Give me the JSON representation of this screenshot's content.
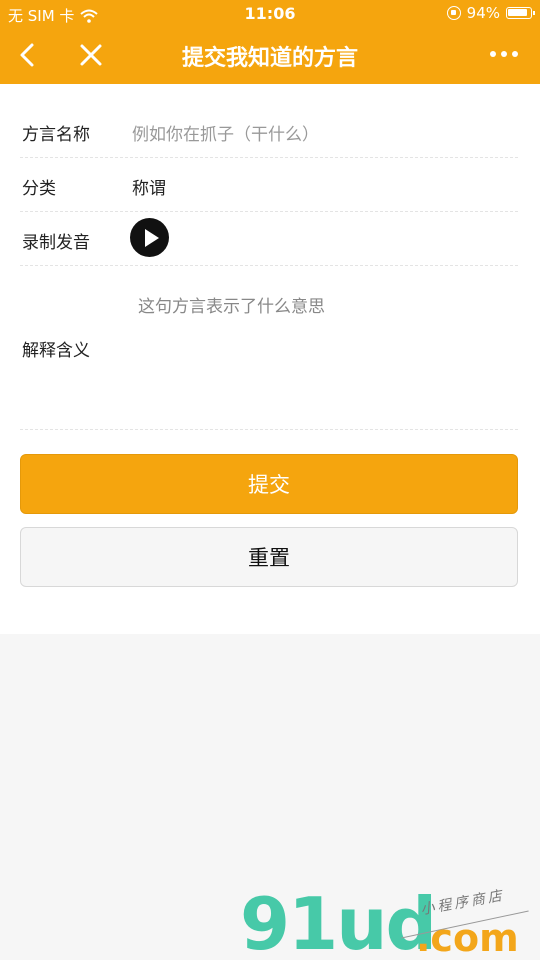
{
  "status_bar": {
    "carrier": "无 SIM 卡",
    "time": "11:06",
    "battery": "94%"
  },
  "nav": {
    "title": "提交我知道的方言"
  },
  "form": {
    "name_label": "方言名称",
    "name_placeholder": "例如你在抓子（干什么）",
    "category_label": "分类",
    "category_value": "称谓",
    "record_label": "录制发音",
    "explain_label": "解释含义",
    "explain_placeholder": "这句方言表示了什么意思"
  },
  "buttons": {
    "submit": "提交",
    "reset": "重置"
  },
  "watermark": {
    "brand": "91ud",
    "domain": ".com",
    "tagline": "小程序商店"
  },
  "colors": {
    "accent": "#f5a50e",
    "watermark_green": "#47c9a8",
    "watermark_orange": "#f3a61a"
  }
}
